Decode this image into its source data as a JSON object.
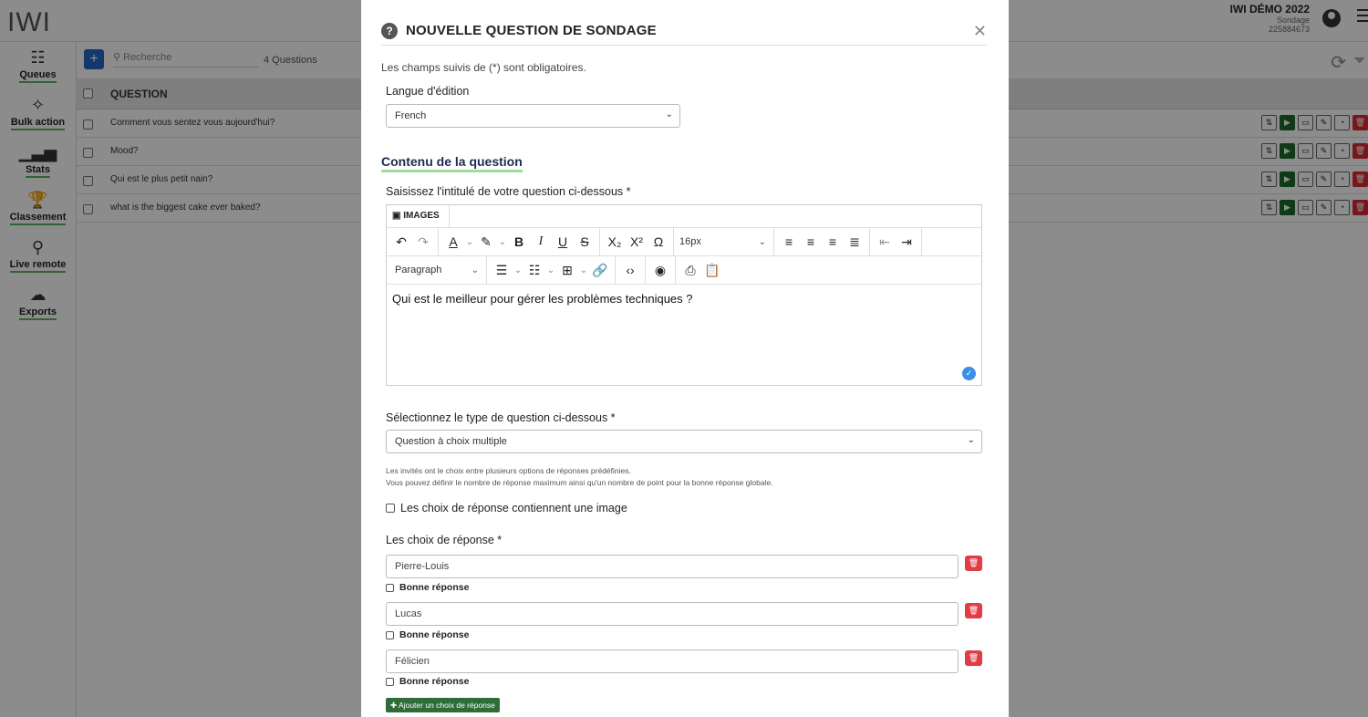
{
  "app": {
    "logo": "IWI",
    "event_title": "IWI DÉMO 2022",
    "event_type": "Sondage",
    "event_id": "225884673"
  },
  "sidebar": {
    "items": [
      {
        "label": "Queues",
        "icon": "grid-icon"
      },
      {
        "label": "Bulk action",
        "icon": "magic-wand-icon"
      },
      {
        "label": "Stats",
        "icon": "bar-chart-icon"
      },
      {
        "label": "Classement",
        "icon": "trophy-icon"
      },
      {
        "label": "Live remote",
        "icon": "joystick-icon"
      },
      {
        "label": "Exports",
        "icon": "cloud-download-icon"
      }
    ]
  },
  "list": {
    "search_placeholder": "Recherche",
    "count": "4 Questions",
    "column_header": "QUESTION",
    "rows": [
      "Comment vous sentez vous aujourd'hui?",
      "Mood?",
      "Qui est le plus petit nain?",
      "what is the biggest cake ever baked?"
    ]
  },
  "modal": {
    "title": "NOUVELLE QUESTION DE SONDAGE",
    "required_note": "Les champs suivis de (*) sont obligatoires.",
    "language_label": "Langue d'édition",
    "language_value": "French",
    "section_title": "Contenu de la question",
    "question_label": "Saisissez l'intitulé de votre question ci-dessous *",
    "images_button": "IMAGES",
    "font_size": "16px",
    "block_format": "Paragraph",
    "question_text": "Qui est le meilleur pour gérer les problèmes techniques ?",
    "type_label": "Sélectionnez le type de question ci-dessous *",
    "type_value": "Question à choix multiple",
    "help_line1": "Les invités ont le choix entre plusieurs options de réponses prédéfinies.",
    "help_line2": "Vous pouvez définir le nombre de réponse maximum ainsi qu'un nombre de point pour la bonne réponse globale.",
    "image_choices_label": "Les choix de réponse contiennent une image",
    "choices_label": "Les choix de réponse *",
    "choices": [
      "Pierre-Louis",
      "Lucas",
      "Félicien"
    ],
    "good_answer_label": "Bonne réponse",
    "add_choice_label": "Ajouter un choix de réponse"
  }
}
